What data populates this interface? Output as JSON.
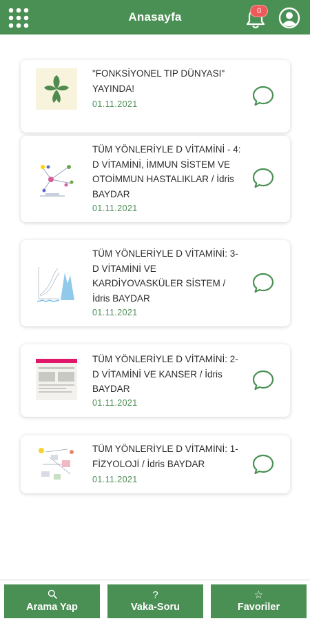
{
  "header": {
    "title": "Anasayfa",
    "notification_count": "0"
  },
  "articles": [
    {
      "title": "\"FONKSİYONEL TIP DÜNYASI\" YAYINDA!",
      "date": "01.11.2021",
      "thumb_icon": "leaf-logo-icon"
    },
    {
      "title": "TÜM YÖNLERİYLE D VİTAMİNİ - 4: D VİTAMİNİ, İMMUN SİSTEM VE OTOİMMUN HASTALIKLAR / İdris BAYDAR",
      "date": "01.11.2021",
      "thumb_icon": "immune-diagram-icon"
    },
    {
      "title": "TÜM YÖNLERİYLE D VİTAMİNİ: 3- D VİTAMİNİ VE KARDİYOVASKÜLER SİSTEM / İdris BAYDAR",
      "date": "01.11.2021",
      "thumb_icon": "graph-icon"
    },
    {
      "title": "TÜM YÖNLERİYLE D VİTAMİNİ: 2- D VİTAMİNİ VE KANSER / İdris BAYDAR",
      "date": "01.11.2021",
      "thumb_icon": "document-icon"
    },
    {
      "title": "TÜM YÖNLERİYLE D VİTAMİNİ: 1-FİZYOLOJİ / İdris BAYDAR",
      "date": "01.11.2021",
      "thumb_icon": "physiology-diagram-icon"
    }
  ],
  "bottom_nav": {
    "search": {
      "icon": "?",
      "label": "Arama Yap"
    },
    "case": {
      "icon": "?",
      "label": "Vaka-Soru"
    },
    "favorites": {
      "icon": "☆",
      "label": "Favoriler"
    }
  },
  "colors": {
    "brand": "#4a8f53",
    "badge": "#ee5a5a",
    "chat_icon": "#4a8f53"
  }
}
